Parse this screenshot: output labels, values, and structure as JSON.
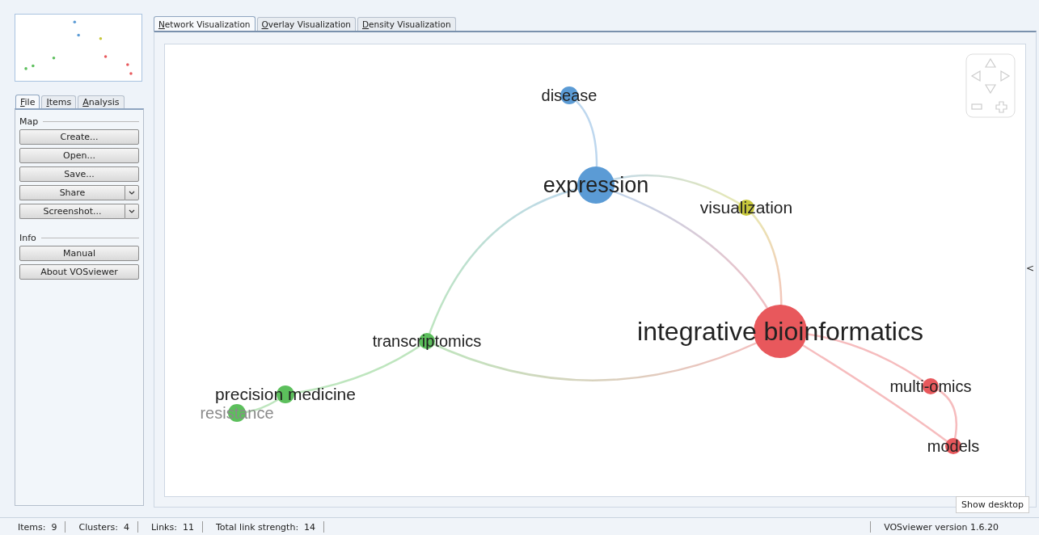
{
  "sidebar": {
    "tabs": [
      {
        "label": "File",
        "selected": true
      },
      {
        "label": "Items",
        "selected": false
      },
      {
        "label": "Analysis",
        "selected": false
      }
    ],
    "sections": [
      {
        "title": "Map",
        "buttons": [
          {
            "label": "Create...",
            "dropdown": false
          },
          {
            "label": "Open...",
            "dropdown": false
          },
          {
            "label": "Save...",
            "dropdown": false
          },
          {
            "label": "Share",
            "dropdown": true
          },
          {
            "label": "Screenshot...",
            "dropdown": true
          }
        ]
      },
      {
        "title": "Info",
        "buttons": [
          {
            "label": "Manual",
            "dropdown": false
          },
          {
            "label": "About VOSviewer",
            "dropdown": false
          }
        ]
      }
    ]
  },
  "view_tabs": [
    {
      "label": "Network Visualization",
      "selected": true
    },
    {
      "label": "Overlay Visualization",
      "selected": false
    },
    {
      "label": "Density Visualization",
      "selected": false
    }
  ],
  "network": {
    "nodes": [
      {
        "label": "disease",
        "color": "#5b9bd5",
        "dimmed": false
      },
      {
        "label": "expression",
        "color": "#5b9bd5",
        "dimmed": false
      },
      {
        "label": "visualization",
        "color": "#c8c83c",
        "dimmed": false
      },
      {
        "label": "integrative bioinformatics",
        "color": "#e8585c",
        "dimmed": false
      },
      {
        "label": "multi-omics",
        "color": "#e8585c",
        "dimmed": false
      },
      {
        "label": "models",
        "color": "#e8585c",
        "dimmed": false
      },
      {
        "label": "transcriptomics",
        "color": "#5cbf5c",
        "dimmed": false
      },
      {
        "label": "precision medicine",
        "color": "#5cbf5c",
        "dimmed": false
      },
      {
        "label": "resistance",
        "color": "#5cbf5c",
        "dimmed": true
      }
    ]
  },
  "collapse_toggle": "<",
  "status_bar": {
    "items": [
      {
        "label": "Items:",
        "value": "9"
      },
      {
        "label": "Clusters:",
        "value": "4"
      },
      {
        "label": "Links:",
        "value": "11"
      },
      {
        "label": "Total link strength:",
        "value": "14"
      }
    ],
    "version": "VOSviewer version 1.6.20"
  },
  "tooltip": "Show desktop"
}
